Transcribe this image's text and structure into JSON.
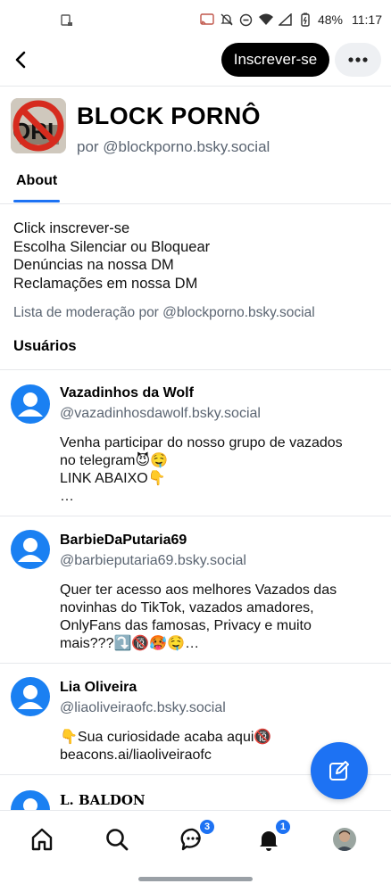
{
  "status_bar": {
    "battery": "48%",
    "time": "11:17"
  },
  "header": {
    "subscribe_label": "Inscrever-se"
  },
  "list": {
    "title": "BLOCK PORNÔ",
    "owner": "por @blockporno.bsky.social"
  },
  "tabs": [
    {
      "label": "About"
    }
  ],
  "description": [
    "Click  inscrever-se",
    "Escolha Silenciar ou Bloquear",
    "Denúncias na nossa DM",
    "Reclamações em nossa DM"
  ],
  "moderation_line": "Lista de moderação por @blockporno.bsky.social",
  "users_heading": "Usuários",
  "users": [
    {
      "name": "Vazadinhos da Wolf",
      "handle": "@vazadinhosdawolf.bsky.social",
      "bio": [
        "Venha participar do nosso grupo de vazados",
        "no telegram😈🤤",
        "LINK ABAIXO👇",
        "…"
      ]
    },
    {
      "name": "BarbieDaPutaria69",
      "handle": "@barbieputaria69.bsky.social",
      "bio": [
        "Quer ter acesso aos melhores Vazados das",
        "novinhas do TikTok, vazados amadores,",
        "OnlyFans das famosas, Privacy e muito",
        "mais???⤵️🔞🥵🤤…"
      ]
    },
    {
      "name": "Lia Oliveira",
      "handle": "@liaoliveiraofc.bsky.social",
      "bio": [
        "👇Sua curiosidade acaba aqui🔞",
        "beacons.ai/liaoliveiraofc"
      ]
    },
    {
      "name": "L. BALDON",
      "handle": "",
      "bio": []
    }
  ],
  "nav": {
    "chat_badge": "3",
    "notifications_badge": "1"
  },
  "colors": {
    "accent": "#1d72f3",
    "avatar_default": "#1a80f2",
    "muted_text": "#5b6572"
  }
}
